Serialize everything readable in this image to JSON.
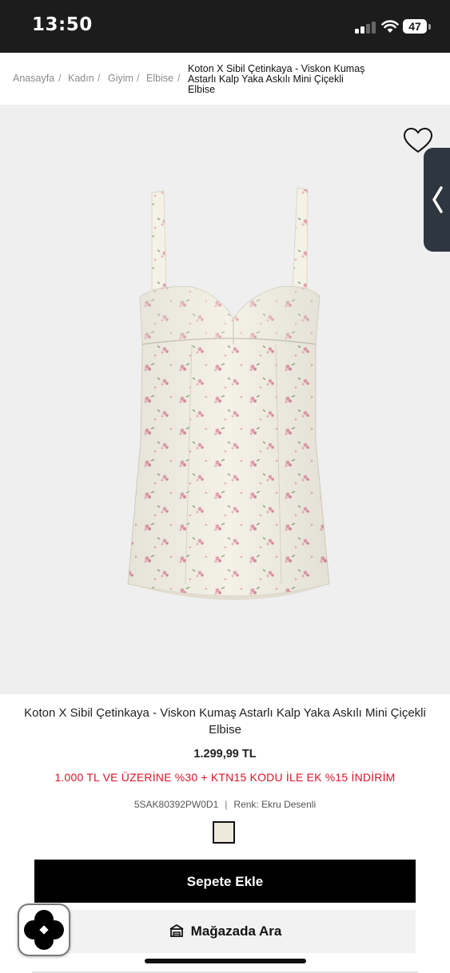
{
  "status_bar": {
    "time": "13:50",
    "battery": "47"
  },
  "breadcrumb": {
    "items": [
      "Anasayfa",
      "Kadın",
      "Giyim",
      "Elbise"
    ],
    "separator": "/",
    "current_lines": [
      "Koton X Sibil Çetinkaya - Viskon Kumaş",
      "Astarlı Kalp Yaka Askılı Mini Çiçekli",
      "Elbise"
    ]
  },
  "product": {
    "title": "Koton X Sibil Çetinkaya - Viskon Kumaş Astarlı Kalp Yaka Askılı Mini Çiçekli Elbise",
    "price": "1.299,99 TL",
    "promo": "1.000 TL VE ÜZERİNE %30 + KTN15 KODU İLE EK %15 İNDİRİM",
    "sku": "5SAK80392PW0D1",
    "color_label": "Renk: Ekru Desenli",
    "meta_separator": "|",
    "swatch_color": "#efe9dc"
  },
  "actions": {
    "add_to_cart": "Sepete Ekle",
    "find_in_store": "Mağazada Ara"
  },
  "icons": [
    "heart-icon",
    "chevron-left-icon",
    "store-icon",
    "clover-app-icon"
  ],
  "colors": {
    "status_bg": "#1c1c1c",
    "promo_red": "#d9142a",
    "primary_button": "#000000",
    "secondary_button": "#f2f2f2"
  }
}
